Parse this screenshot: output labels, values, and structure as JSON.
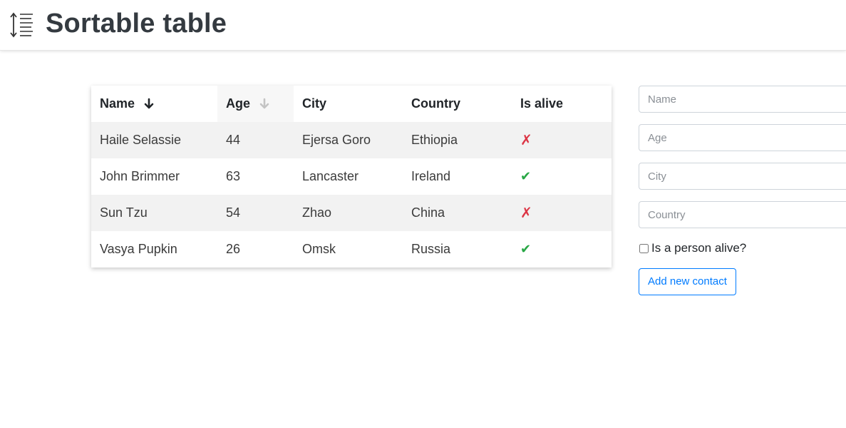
{
  "header": {
    "title": "Sortable table",
    "icon": "sort-vertical-lines-icon"
  },
  "table": {
    "columns": [
      {
        "label": "Name",
        "sort_icon": "arrow-down-icon",
        "sort_state": "active"
      },
      {
        "label": "Age",
        "sort_icon": "arrow-down-icon",
        "sort_state": "inactive"
      },
      {
        "label": "City"
      },
      {
        "label": "Country"
      },
      {
        "label": "Is alive"
      }
    ],
    "rows": [
      {
        "name": "Haile Selassie",
        "age": "44",
        "city": "Ejersa Goro",
        "country": "Ethiopia",
        "alive_symbol": "✗",
        "alive_icon": "cross-icon"
      },
      {
        "name": "John Brimmer",
        "age": "63",
        "city": "Lancaster",
        "country": "Ireland",
        "alive_symbol": "✔",
        "alive_icon": "check-icon"
      },
      {
        "name": "Sun Tzu",
        "age": "54",
        "city": "Zhao",
        "country": "China",
        "alive_symbol": "✗",
        "alive_icon": "cross-icon"
      },
      {
        "name": "Vasya Pupkin",
        "age": "26",
        "city": "Omsk",
        "country": "Russia",
        "alive_symbol": "✔",
        "alive_icon": "check-icon"
      }
    ]
  },
  "form": {
    "name_placeholder": "Name",
    "age_placeholder": "Age",
    "city_placeholder": "City",
    "country_placeholder": "Country",
    "alive_label": "Is a person alive?",
    "submit_label": "Add new contact"
  },
  "colors": {
    "accent": "#007bff",
    "alive_yes": "#28a745",
    "alive_no": "#dc3545",
    "stripe": "#f2f2f2"
  }
}
